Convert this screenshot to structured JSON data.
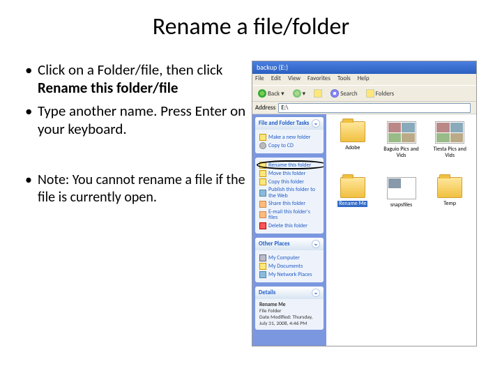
{
  "title": "Rename a file/folder",
  "bullets": {
    "b1a": "Click on a Folder/file, then click ",
    "b1b": "Rename this folder/file",
    "b2": "Type another name. Press Enter on your keyboard.",
    "note": "Note: You cannot rename a file if the file is currently open."
  },
  "dot": "•",
  "window": {
    "title": "backup (E:)",
    "menu": {
      "file": "File",
      "edit": "Edit",
      "view": "View",
      "favorites": "Favorites",
      "tools": "Tools",
      "help": "Help"
    },
    "toolbar": {
      "back": "Back",
      "search": "Search",
      "folders": "Folders"
    },
    "address": {
      "label": "Address",
      "value": "E:\\"
    }
  },
  "tasks": {
    "head1": "File and Folder Tasks",
    "new": "Make a new folder",
    "cd": "Copy to CD",
    "rename": "Rename this folder",
    "move": "Move this folder",
    "copy": "Copy this folder",
    "publish": "Publish this folder to the Web",
    "share": "Share this folder",
    "email": "E-mail this folder's files",
    "delete": "Delete this folder",
    "head2": "Other Places",
    "mycomp": "My Computer",
    "mydocs": "My Documents",
    "network": "My Network Places",
    "head3": "Details",
    "details_name": "Rename Me",
    "details_type": "File Folder",
    "details_mod": "Date Modified: Thursday, July 31, 2008, 4:46 PM"
  },
  "files": {
    "f1": "Adobe",
    "f2": "Baguio Pics and Vids",
    "f3": "Tiesta Pics and Vids",
    "f4": "Rename Me",
    "f5": "snapsfiles",
    "f6": "Temp"
  }
}
